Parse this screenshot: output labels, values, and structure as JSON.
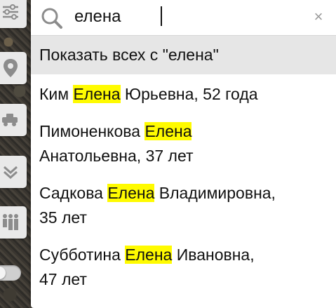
{
  "search": {
    "value": "елена",
    "placeholder": ""
  },
  "show_all_label": "Показать всех с \"елена\"",
  "results": [
    {
      "before": "Ким ",
      "match": "Елена",
      "after": " Юрьевна, 52 года",
      "line2": ""
    },
    {
      "before": "Пимоненкова ",
      "match": "Елена",
      "after": "",
      "line2": "Анатольевна, 37 лет"
    },
    {
      "before": "Садкова ",
      "match": "Елена",
      "after": " Владимировна,",
      "line2": "35 лет"
    },
    {
      "before": "Субботина ",
      "match": "Елена",
      "after": " Ивановна,",
      "line2": "47 лет"
    }
  ],
  "colors": {
    "highlight": "#fffb00",
    "show_all_bg": "#e6e6e6",
    "tool_bg": "#e9e9e9",
    "icon": "#8c8c8c"
  },
  "icons": {
    "search": "search-icon",
    "clear": "close-icon",
    "tools": [
      "filter-sliders-icon",
      "location-pin-icon",
      "vehicle-icon",
      "layers-chevron-icon",
      "people-group-icon"
    ]
  }
}
